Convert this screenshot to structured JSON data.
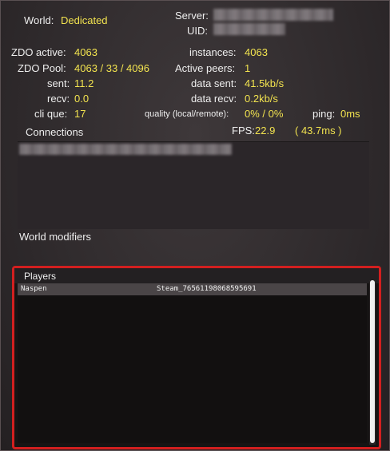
{
  "server_info": {
    "world_label": "World:",
    "world_value": "Dedicated",
    "server_label": "Server:",
    "uid_label": "UID:"
  },
  "stats": {
    "zdo_active_label": "ZDO active:",
    "zdo_active_value": "4063",
    "zdo_pool_label": "ZDO Pool:",
    "zdo_pool_value": "4063 / 33 / 4096",
    "sent_label": "sent:",
    "sent_value": "11.2",
    "recv_label": "recv:",
    "recv_value": "0.0",
    "cli_que_label": "cli que:",
    "cli_que_value": "17",
    "instances_label": "instances:",
    "instances_value": "4063",
    "active_peers_label": "Active peers:",
    "active_peers_value": "1",
    "data_sent_label": "data sent:",
    "data_sent_value": "41.5kb/s",
    "data_recv_label": "data recv:",
    "data_recv_value": "0.2kb/s",
    "quality_label": "quality (local/remote):",
    "quality_value": "0% / 0%",
    "ping_label": "ping:",
    "ping_value": "0ms",
    "fps_label": "FPS:",
    "fps_value": "22.9",
    "frame_time_value": "( 43.7ms )"
  },
  "connections": {
    "title": "Connections"
  },
  "world_modifiers": {
    "title": "World modifiers"
  },
  "players": {
    "title": "Players",
    "rows": [
      {
        "name": "Naspen",
        "id": "Steam_76561198068595691"
      }
    ]
  },
  "colors": {
    "value_yellow": "#f2e34f",
    "highlight_red": "#d21f1f"
  }
}
